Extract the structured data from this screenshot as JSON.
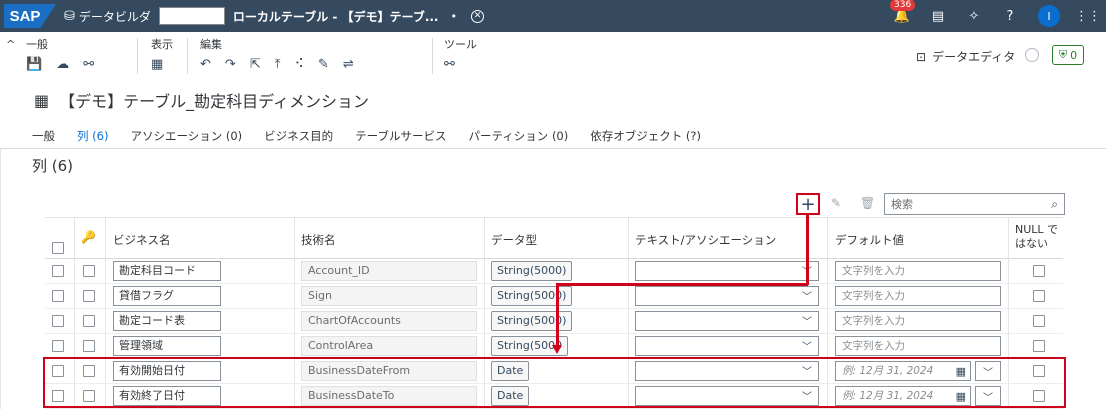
{
  "shell": {
    "logo": "SAP",
    "app_name": "データビルダ",
    "doc_title": "ローカルテーブル - 【デモ】テーブ...",
    "modified_dot": "•",
    "notification_count": "336",
    "avatar_initial": "I"
  },
  "toolbar": {
    "groups": {
      "general": "一般",
      "view": "表示",
      "edit": "編集",
      "tools": "ツール"
    },
    "data_editor_label": "データエディタ",
    "deploy_count": "0"
  },
  "page": {
    "title": "【デモ】テーブル_勘定科目ディメンション",
    "tabs": [
      "一般",
      "列 (6)",
      "アソシエーション (0)",
      "ビジネス目的",
      "テーブルサービス",
      "パーティション (0)",
      "依存オブジェクト (?)"
    ],
    "section_title": "列 (6)"
  },
  "table": {
    "search_placeholder": "検索",
    "headers": {
      "business_name": "ビジネス名",
      "technical_name": "技術名",
      "data_type": "データ型",
      "text_association": "テキスト/アソシエーション",
      "default_value": "デフォルト値",
      "not_null_line1": "NULL で",
      "not_null_line2": "はない"
    },
    "rows": [
      {
        "business_name": "勘定科目コード",
        "technical_name": "Account_ID",
        "data_type": "String(5000)",
        "default_value": "文字列を入力"
      },
      {
        "business_name": "貸借フラグ",
        "technical_name": "Sign",
        "data_type": "String(5000)",
        "default_value": "文字列を入力"
      },
      {
        "business_name": "勘定コード表",
        "technical_name": "ChartOfAccounts",
        "data_type": "String(5000)",
        "default_value": "文字列を入力"
      },
      {
        "business_name": "管理領域",
        "technical_name": "ControlArea",
        "data_type": "String(5000",
        "default_value": "文字列を入力"
      },
      {
        "business_name": "有効開始日付",
        "technical_name": "BusinessDateFrom",
        "data_type": "Date",
        "default_value": "例: 12月 31, 2024"
      },
      {
        "business_name": "有効終了日付",
        "technical_name": "BusinessDateTo",
        "data_type": "Date",
        "default_value": "例: 12月 31, 2024"
      }
    ]
  },
  "colors": {
    "shell_bg": "#354a5f",
    "accent": "#0a6ed1",
    "highlight": "#d0021b"
  }
}
